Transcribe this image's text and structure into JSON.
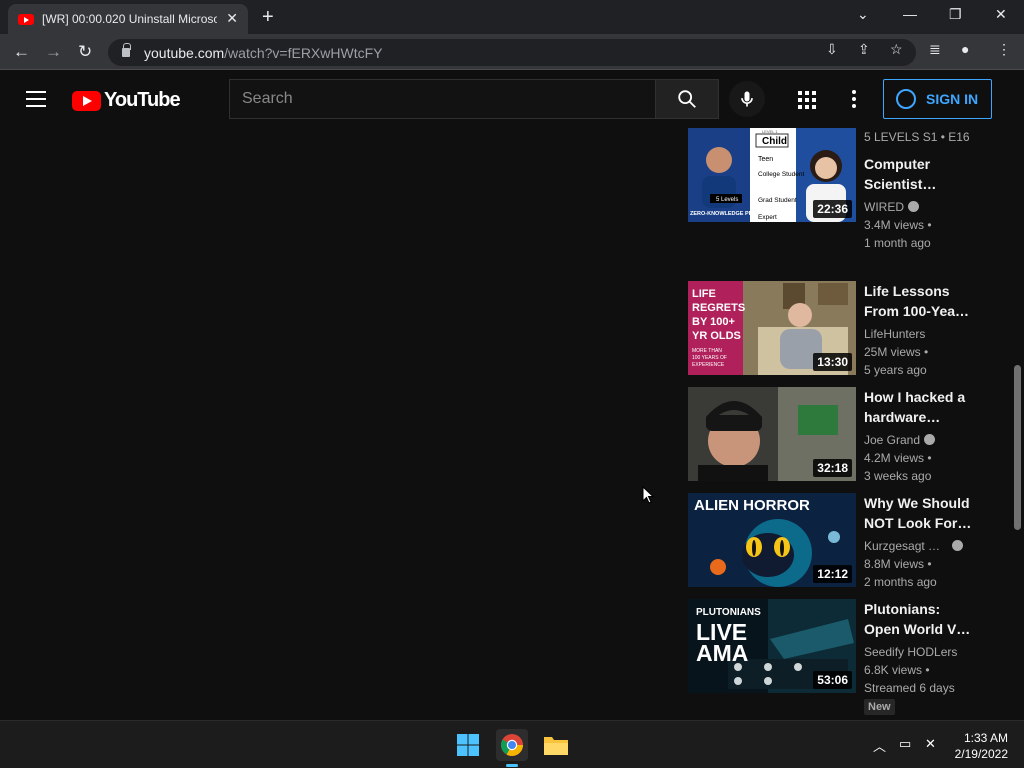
{
  "browser": {
    "tab_title": "[WR] 00:00.020 Uninstall Microso",
    "url_host": "youtube.com",
    "url_path": "/watch?v=fERXwHWtcFY"
  },
  "youtube": {
    "logo_text": "YouTube",
    "search_placeholder": "Search",
    "signin_label": "SIGN IN"
  },
  "recommendations": [
    {
      "series": "5 LEVELS  S1 • E16",
      "title_l1": "Computer",
      "title_l2": "Scientist…",
      "channel": "WIRED",
      "verified": true,
      "views": "3.4M views •",
      "age": "1 month ago",
      "duration": "22:36",
      "thumb_labels": {
        "level": "LEVEL 1",
        "child": "Child",
        "teen": "Teen",
        "college": "College Student",
        "grad": "Grad Student",
        "expert": "Expert",
        "brand": "5 Levels",
        "topic": "ZERO-KNOWLEDGE PROOF"
      }
    },
    {
      "title_l1": "Life Lessons",
      "title_l2": "From 100-Yea…",
      "channel": "LifeHunters",
      "views": "25M views •",
      "age": "5 years ago",
      "duration": "13:30",
      "thumb_text": [
        "LIFE",
        "REGRETS",
        "BY 100+",
        "YR OLDS"
      ],
      "thumb_sub": [
        "MORE THAN",
        "100 YEARS OF",
        "EXPERIENCE"
      ]
    },
    {
      "title_l1": "How I hacked a",
      "title_l2": "hardware…",
      "channel": "Joe Grand",
      "verified": true,
      "views": "4.2M views •",
      "age": "3 weeks ago",
      "duration": "32:18"
    },
    {
      "title_l1": "Why We Should",
      "title_l2": "NOT Look For…",
      "channel": "Kurzgesagt …",
      "verified": true,
      "views": "8.8M views •",
      "age": "2 months ago",
      "duration": "12:12",
      "thumb_text": "ALIEN HORROR"
    },
    {
      "title_l1": "Plutonians:",
      "title_l2": "Open World V…",
      "channel": "Seedify HODLers",
      "views": "6.8K views •",
      "age": "Streamed 6 days",
      "badge": "New",
      "duration": "53:06",
      "thumb_brand": "PLUTONIANS",
      "thumb_live": "LIVE",
      "thumb_ama": "AMA"
    }
  ],
  "taskbar": {
    "time": "1:33 AM",
    "date": "2/19/2022"
  },
  "colors": {
    "yt_red": "#ff0000",
    "accent_blue": "#3ea6ff",
    "background": "#0f0f0f"
  }
}
